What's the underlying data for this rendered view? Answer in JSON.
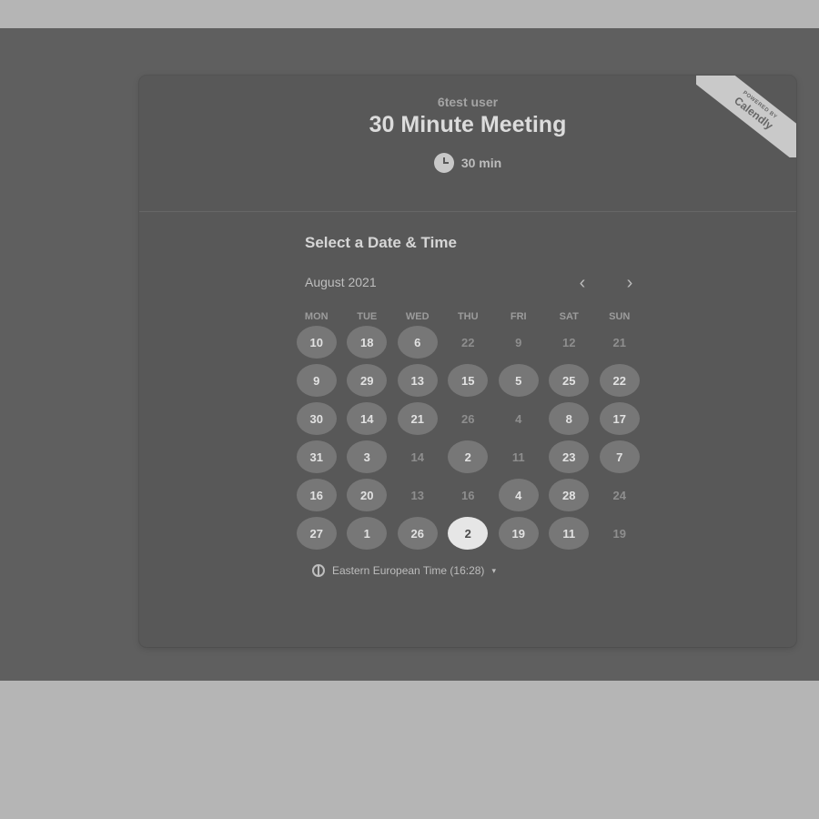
{
  "header": {
    "host_name": "6test user",
    "event_title": "30 Minute Meeting",
    "duration": "30 min",
    "ribbon": {
      "powered_by": "POWERED BY",
      "brand": "Calendly"
    }
  },
  "calendar": {
    "section_title": "Select a Date & Time",
    "month_label": "August 2021",
    "nav": {
      "prev": "‹",
      "next": "›"
    },
    "weekdays": [
      "MON",
      "TUE",
      "WED",
      "THU",
      "FRI",
      "SAT",
      "SUN"
    ],
    "rows": [
      [
        {
          "day": "10",
          "state": "available"
        },
        {
          "day": "18",
          "state": "available"
        },
        {
          "day": "6",
          "state": "available"
        },
        {
          "day": "22",
          "state": "unavailable"
        },
        {
          "day": "9",
          "state": "unavailable"
        },
        {
          "day": "12",
          "state": "unavailable"
        },
        {
          "day": "21",
          "state": "unavailable"
        }
      ],
      [
        {
          "day": "9",
          "state": "available"
        },
        {
          "day": "29",
          "state": "available"
        },
        {
          "day": "13",
          "state": "available"
        },
        {
          "day": "15",
          "state": "available"
        },
        {
          "day": "5",
          "state": "available"
        },
        {
          "day": "25",
          "state": "available"
        },
        {
          "day": "22",
          "state": "available"
        }
      ],
      [
        {
          "day": "30",
          "state": "available"
        },
        {
          "day": "14",
          "state": "available"
        },
        {
          "day": "21",
          "state": "available"
        },
        {
          "day": "26",
          "state": "unavailable"
        },
        {
          "day": "4",
          "state": "unavailable"
        },
        {
          "day": "8",
          "state": "available"
        },
        {
          "day": "17",
          "state": "available"
        }
      ],
      [
        {
          "day": "31",
          "state": "available"
        },
        {
          "day": "3",
          "state": "available"
        },
        {
          "day": "14",
          "state": "unavailable"
        },
        {
          "day": "2",
          "state": "available"
        },
        {
          "day": "11",
          "state": "unavailable"
        },
        {
          "day": "23",
          "state": "available"
        },
        {
          "day": "7",
          "state": "available"
        }
      ],
      [
        {
          "day": "16",
          "state": "available"
        },
        {
          "day": "20",
          "state": "available"
        },
        {
          "day": "13",
          "state": "unavailable"
        },
        {
          "day": "16",
          "state": "unavailable"
        },
        {
          "day": "4",
          "state": "available"
        },
        {
          "day": "28",
          "state": "available"
        },
        {
          "day": "24",
          "state": "unavailable"
        }
      ],
      [
        {
          "day": "27",
          "state": "available"
        },
        {
          "day": "1",
          "state": "available"
        },
        {
          "day": "26",
          "state": "available"
        },
        {
          "day": "2",
          "state": "selected"
        },
        {
          "day": "19",
          "state": "available"
        },
        {
          "day": "11",
          "state": "available"
        },
        {
          "day": "19",
          "state": "unavailable"
        }
      ]
    ]
  },
  "timezone": {
    "label": "Eastern European Time (16:28)",
    "caret": "▾"
  }
}
